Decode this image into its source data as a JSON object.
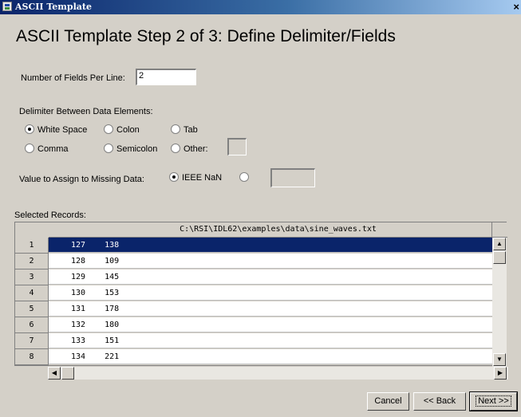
{
  "window": {
    "title": "ASCII Template",
    "close_glyph": "×"
  },
  "heading": "ASCII Template Step 2 of 3: Define Delimiter/Fields",
  "fields_per_line": {
    "label": "Number of Fields Per Line:",
    "value": "2"
  },
  "delimiter": {
    "label": "Delimiter Between Data Elements:",
    "options": [
      "White Space",
      "Colon",
      "Tab",
      "Comma",
      "Semicolon",
      "Other:"
    ],
    "selected": "White Space",
    "other_value": ""
  },
  "missing": {
    "label": "Value to Assign to Missing Data:",
    "options": [
      "IEEE NaN",
      ""
    ],
    "selected": "IEEE NaN",
    "custom_value": ""
  },
  "records": {
    "label": "Selected Records:",
    "file_path": "C:\\RSI\\IDL62\\examples\\data\\sine_waves.txt",
    "rows": [
      {
        "num": "1",
        "text": "127    138"
      },
      {
        "num": "2",
        "text": "128    109"
      },
      {
        "num": "3",
        "text": "129    145"
      },
      {
        "num": "4",
        "text": "130    153"
      },
      {
        "num": "5",
        "text": "131    178"
      },
      {
        "num": "6",
        "text": "132    180"
      },
      {
        "num": "7",
        "text": "133    151"
      },
      {
        "num": "8",
        "text": "134    221"
      }
    ],
    "selected_row": "1"
  },
  "icons": {
    "app": "window-icon",
    "up": "▲",
    "down": "▼",
    "left": "◀",
    "right": "▶"
  },
  "buttons": {
    "cancel": "Cancel",
    "back": "<< Back",
    "next": "Next >>"
  },
  "colors": {
    "selection": "#0a246a",
    "titlebar": "#0a246a",
    "face": "#d4d0c8"
  }
}
